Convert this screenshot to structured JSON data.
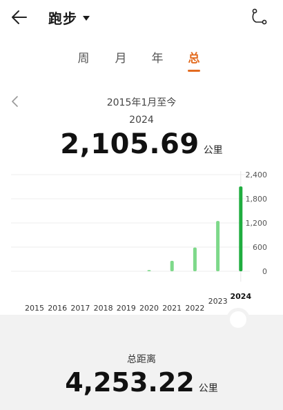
{
  "header": {
    "title": "跑步",
    "back_icon": "arrow-left-icon",
    "route_icon": "route-icon"
  },
  "tabs": [
    {
      "label": "周",
      "active": false
    },
    {
      "label": "月",
      "active": false
    },
    {
      "label": "年",
      "active": false
    },
    {
      "label": "总",
      "active": true
    }
  ],
  "accent_color": "#e36b1f",
  "bar_color": "#7ed98a",
  "bar_color_selected": "#1fad3f",
  "period": {
    "label": "2015年1月至今",
    "prev_icon": "chevron-left-icon"
  },
  "selected": {
    "year": "2024",
    "value": "2,105.69",
    "unit": "公里"
  },
  "summary": {
    "label": "总距离",
    "value": "4,253.22",
    "unit": "公里"
  },
  "chart_data": {
    "type": "bar",
    "categories": [
      "2015",
      "2016",
      "2017",
      "2018",
      "2019",
      "2020",
      "2021",
      "2022",
      "2023",
      "2024"
    ],
    "values": [
      0,
      0,
      0,
      0,
      0,
      30,
      260,
      590,
      1250,
      2105.69
    ],
    "selected_category": "2024",
    "ylim": [
      0,
      2400
    ],
    "yticks": [
      "2,400",
      "1,800",
      "1,200",
      "600",
      "0"
    ],
    "ytick_values": [
      2400,
      1800,
      1200,
      600,
      0
    ],
    "grid": true,
    "xlabel": "",
    "ylabel": ""
  }
}
